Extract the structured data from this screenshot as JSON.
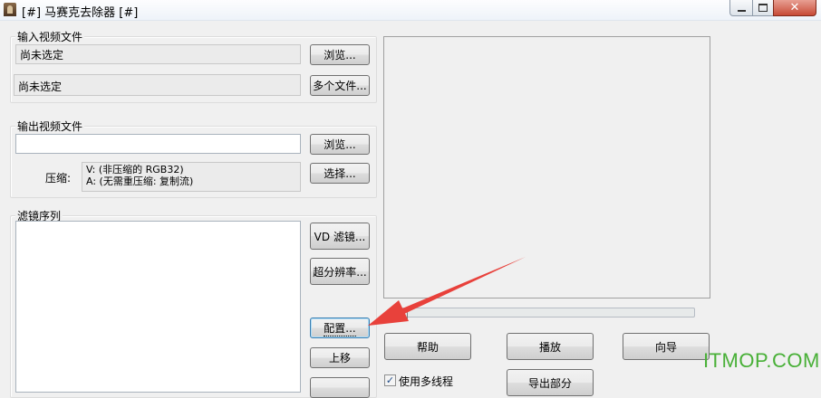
{
  "window": {
    "title": "[#] 马赛克去除器 [#]",
    "min_glyph": "",
    "close_glyph": "✕"
  },
  "input_group": {
    "label": "输入视频文件",
    "file_field": "尚未选定",
    "browse_button": "浏览...",
    "multi_field": "尚未选定",
    "multi_button": "多个文件..."
  },
  "output_group": {
    "label": "输出视频文件",
    "file_field": "",
    "browse_button": "浏览...",
    "compress_label": "压缩:",
    "compress_video": "V: (非压缩的 RGB32)",
    "compress_audio": "A: (无需重压缩: 复制流)",
    "select_button": "选择..."
  },
  "filter_group": {
    "label": "滤镜序列",
    "vd_filter_button": "VD 滤镜...",
    "super_res_button": "超分辨率...",
    "config_button": "配置...",
    "move_up_button": "上移"
  },
  "controls": {
    "help_button": "帮助",
    "play_button": "播放",
    "wizard_button": "向导",
    "multithread_label": "使用多线程",
    "partial_button": "导出部分"
  },
  "watermark": "ITMOP.COM",
  "colors": {
    "arrow": "#e8413b",
    "watermark": "#48b037"
  }
}
